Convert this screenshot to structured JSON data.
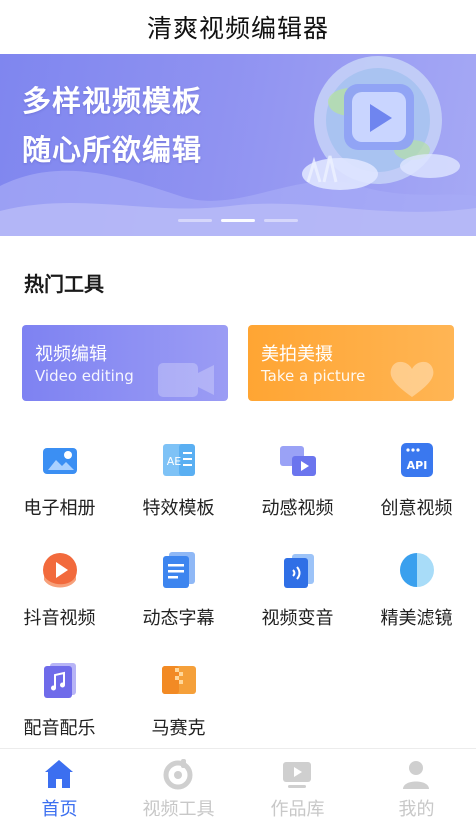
{
  "app": {
    "title": "清爽视频编辑器"
  },
  "banner": {
    "line1": "多样视频模板",
    "line2": "随心所欲编辑",
    "slide_count": 3,
    "active_slide": 2
  },
  "hot_tools": {
    "title": "热门工具",
    "cards": [
      {
        "title": "视频编辑",
        "subtitle": "Video editing"
      },
      {
        "title": "美拍美摄",
        "subtitle": "Take a picture"
      }
    ],
    "grid": [
      {
        "label": "电子相册",
        "icon": "photo-album-icon"
      },
      {
        "label": "特效模板",
        "icon": "effects-template-icon"
      },
      {
        "label": "动感视频",
        "icon": "dynamic-video-icon"
      },
      {
        "label": "创意视频",
        "icon": "api-creative-icon"
      },
      {
        "label": "抖音视频",
        "icon": "douyin-play-icon"
      },
      {
        "label": "动态字幕",
        "icon": "subtitles-icon"
      },
      {
        "label": "视频变音",
        "icon": "voice-change-icon"
      },
      {
        "label": "精美滤镜",
        "icon": "filter-icon"
      },
      {
        "label": "配音配乐",
        "icon": "music-icon"
      },
      {
        "label": "马赛克",
        "icon": "mosaic-icon"
      }
    ]
  },
  "tabbar": {
    "tabs": [
      {
        "label": "首页",
        "icon": "home-icon",
        "active": true
      },
      {
        "label": "视频工具",
        "icon": "video-tools-icon",
        "active": false
      },
      {
        "label": "作品库",
        "icon": "works-library-icon",
        "active": false
      },
      {
        "label": "我的",
        "icon": "profile-icon",
        "active": false
      }
    ]
  },
  "colors": {
    "banner": "#8a8ef0",
    "video_card": "#7e82f2",
    "photo_card": "#ffa533",
    "tab_active": "#3c6ff0",
    "tab_inactive": "#c8c8c8"
  }
}
